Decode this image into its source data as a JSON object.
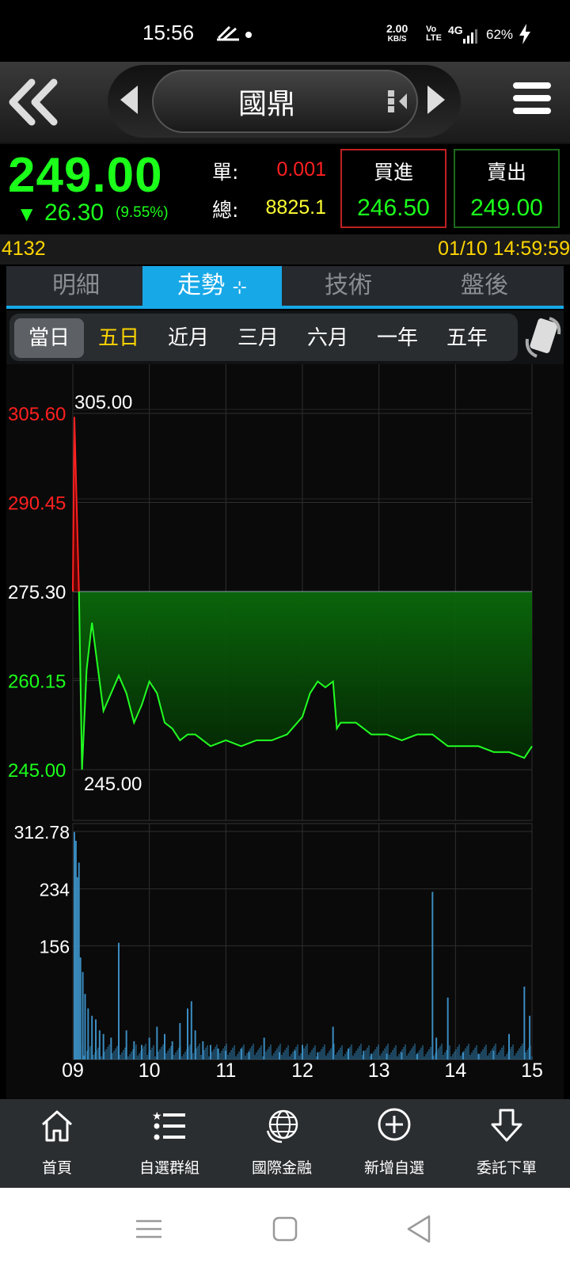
{
  "status_bar": {
    "time": "15:56",
    "net_speed_value": "2.00",
    "net_speed_unit": "KB/S",
    "volte_top": "Vo",
    "volte_bottom": "LTE",
    "network": "4G",
    "battery": "62%"
  },
  "header": {
    "stock_name": "國鼎"
  },
  "quote": {
    "price": "249.00",
    "change": "26.30",
    "change_pct": "(9.55%)",
    "single_label": "單:",
    "single_value": "0.001",
    "total_label": "總:",
    "total_value": "8825.1",
    "buy_label": "買進",
    "buy_value": "246.50",
    "sell_label": "賣出",
    "sell_value": "249.00"
  },
  "info": {
    "code": "4132",
    "datetime": "01/10 14:59:59"
  },
  "tabs": [
    {
      "label": "明細"
    },
    {
      "label": "走勢"
    },
    {
      "label": "技術"
    },
    {
      "label": "盤後"
    }
  ],
  "ranges": [
    {
      "label": "當日"
    },
    {
      "label": "五日"
    },
    {
      "label": "近月"
    },
    {
      "label": "三月"
    },
    {
      "label": "六月"
    },
    {
      "label": "一年"
    },
    {
      "label": "五年"
    }
  ],
  "chart_data": {
    "type": "line",
    "price_axis": {
      "ticks": [
        "305.60",
        "290.45",
        "275.30",
        "260.15",
        "245.00"
      ],
      "ylim": [
        245.0,
        305.6
      ],
      "reference": 275.3
    },
    "annotations": {
      "high": "305.00",
      "low": "245.00"
    },
    "x_ticks": [
      "09",
      "10",
      "11",
      "12",
      "13",
      "14",
      "15"
    ],
    "series": [
      {
        "x": [
          9.0,
          9.02,
          9.05,
          9.08,
          9.12,
          9.18,
          9.25,
          9.3,
          9.4,
          9.5,
          9.6,
          9.7,
          9.8,
          9.9,
          10.0,
          10.1,
          10.2,
          10.3,
          10.4,
          10.5,
          10.6,
          10.8,
          11.0,
          11.2,
          11.4,
          11.6,
          11.8,
          12.0,
          12.1,
          12.2,
          12.3,
          12.4,
          12.45,
          12.5,
          12.7,
          12.9,
          13.1,
          13.3,
          13.5,
          13.7,
          13.9,
          14.1,
          14.3,
          14.5,
          14.7,
          14.9,
          15.0
        ],
        "y": [
          275.3,
          305.0,
          290.0,
          275.3,
          245.0,
          262.0,
          270.0,
          265.0,
          255.0,
          258.0,
          261.0,
          258.0,
          253.0,
          256.0,
          260.0,
          258.0,
          253.0,
          252.0,
          250.0,
          251.0,
          251.0,
          249.0,
          250.0,
          249.0,
          250.0,
          250.0,
          251.0,
          254.0,
          258.0,
          260.0,
          259.0,
          260.0,
          252.0,
          253.0,
          253.0,
          251.0,
          251.0,
          250.0,
          251.0,
          251.0,
          249.0,
          249.0,
          249.0,
          248.0,
          248.0,
          247.0,
          249.0
        ]
      }
    ],
    "volume_axis": {
      "ticks": [
        "312.78",
        "234",
        "156"
      ],
      "ylim": [
        0,
        312.78
      ]
    },
    "volume": {
      "x": [
        9.02,
        9.04,
        9.06,
        9.08,
        9.1,
        9.13,
        9.16,
        9.2,
        9.25,
        9.3,
        9.35,
        9.4,
        9.5,
        9.6,
        9.7,
        9.8,
        9.9,
        10.0,
        10.1,
        10.2,
        10.3,
        10.4,
        10.5,
        10.55,
        10.6,
        10.7,
        10.8,
        10.9,
        11.0,
        11.2,
        11.3,
        11.5,
        11.7,
        11.9,
        12.0,
        12.2,
        12.4,
        12.6,
        12.8,
        12.9,
        13.1,
        13.3,
        13.5,
        13.7,
        13.75,
        13.9,
        14.1,
        14.3,
        14.5,
        14.7,
        14.9,
        14.97
      ],
      "y": [
        312,
        300,
        250,
        270,
        140,
        120,
        90,
        70,
        60,
        55,
        40,
        35,
        30,
        160,
        40,
        25,
        20,
        30,
        45,
        35,
        25,
        50,
        70,
        80,
        40,
        25,
        20,
        15,
        12,
        15,
        10,
        30,
        10,
        12,
        20,
        10,
        45,
        15,
        12,
        8,
        8,
        10,
        8,
        230,
        30,
        85,
        10,
        8,
        12,
        35,
        100,
        60
      ]
    }
  },
  "bottom_nav": [
    {
      "label": "首頁",
      "icon": "home-icon"
    },
    {
      "label": "自選群組",
      "icon": "list-icon"
    },
    {
      "label": "國際金融",
      "icon": "globe-icon"
    },
    {
      "label": "新增自選",
      "icon": "add-circle-icon"
    },
    {
      "label": "委託下單",
      "icon": "order-down-icon"
    }
  ],
  "colors": {
    "up": "#ff2020",
    "down": "#1bff1b",
    "accent": "#17a8e8",
    "highlight": "#ffd500"
  }
}
